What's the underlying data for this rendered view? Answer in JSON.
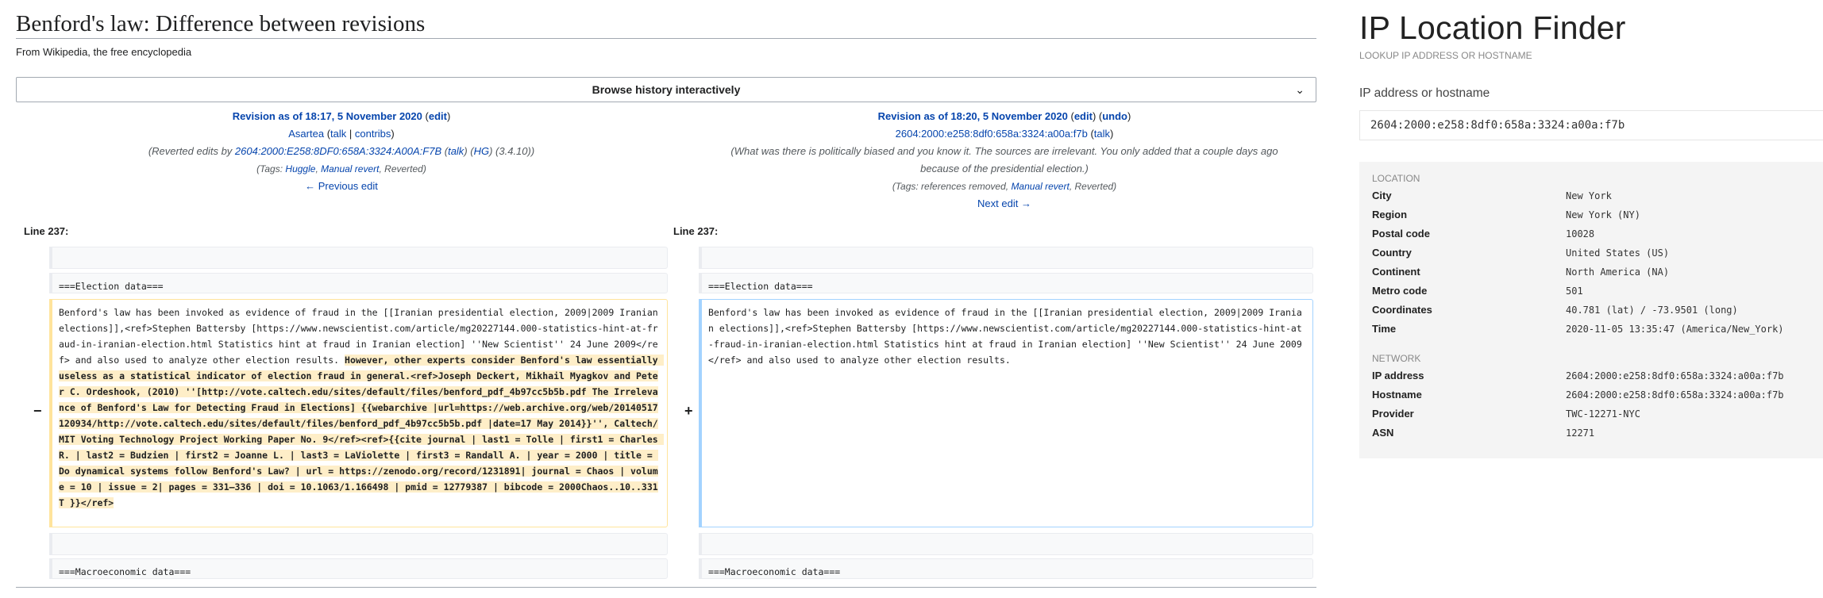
{
  "wiki": {
    "title": "Benford's law: Difference between revisions",
    "tagline": "From Wikipedia, the free encyclopedia",
    "browse_label": "Browse history interactively",
    "left_rev": {
      "heading": "Revision as of 18:17, 5 November 2020",
      "edit": "edit",
      "user": "Asartea",
      "talk": "talk",
      "contribs": "contribs",
      "summary_prefix": "(Reverted edits by ",
      "summary_ip": "2604:2000:E258:8DF0:658A:3324:A00A:F7B",
      "summary_talk": "talk",
      "summary_hg": "HG",
      "summary_suffix": "(3.4.10))",
      "tags_prefix": "(Tags: ",
      "tag1": "Huggle",
      "tag2": "Manual revert",
      "tags_suffix": ", Reverted)",
      "nav": "← Previous edit"
    },
    "right_rev": {
      "heading": "Revision as of 18:20, 5 November 2020",
      "edit": "edit",
      "undo": "undo",
      "user": "2604:2000:e258:8df0:658a:3324:a00a:f7b",
      "talk": "talk",
      "summary_line1": "(What was there is politically biased and you know it. The sources are irrelevant. You only added that a couple days ago",
      "summary_line2": "because of the presidential election.)",
      "tags_prefix": "(Tags: references removed, ",
      "tag1": "Manual revert",
      "tags_suffix": ", Reverted)",
      "nav": "Next edit →"
    },
    "line_label_left": "Line 237:",
    "line_label_right": "Line 237:",
    "context_election": "===Election data===",
    "context_macro": "===Macroeconomic data===",
    "marker_minus": "−",
    "marker_plus": "+",
    "removed_before": "Benford's law has been invoked as evidence of fraud in the [[Iranian presidential election, 2009|2009 Iranian elections]],<ref>Stephen Battersby [https://www.newscientist.com/article/mg20227144.000-statistics-hint-at-fraud-in-iranian-election.html Statistics hint at fraud in Iranian election] ''New Scientist'' 24 June 2009</ref> and also used to analyze other election results. ",
    "removed_highlight": "However, other experts consider Benford's law essentially useless as a statistical indicator of election fraud in general.<ref>Joseph Deckert, Mikhail Myagkov and Peter C. Ordeshook, (2010) ''[http://vote.caltech.edu/sites/default/files/benford_pdf_4b97cc5b5b.pdf The Irrelevance of Benford's Law for Detecting Fraud in Elections] {{webarchive |url=https://web.archive.org/web/20140517120934/http://vote.caltech.edu/sites/default/files/benford_pdf_4b97cc5b5b.pdf |date=17 May 2014}}'', Caltech/MIT Voting Technology Project Working Paper No. 9</ref><ref>{{cite journal | last1 = Tolle | first1 = Charles R. | last2 = Budzien | first2 = Joanne L. | last3 = LaViolette | first3 = Randall A. | year = 2000 | title = Do dynamical systems follow Benford's Law? | url = https://zenodo.org/record/1231891| journal = Chaos | volume = 10 | issue = 2| pages = 331–336 | doi = 10.1063/1.166498 | pmid = 12779387 | bibcode = 2000Chaos..10..331T }}</ref>",
    "added_text": "Benford's law has been invoked as evidence of fraud in the [[Iranian presidential election, 2009|2009 Iranian elections]],<ref>Stephen Battersby [https://www.newscientist.com/article/mg20227144.000-statistics-hint-at-fraud-in-iranian-election.html Statistics hint at fraud in Iranian election] ''New Scientist'' 24 June 2009</ref> and also used to analyze other election results."
  },
  "ip": {
    "title": "IP Location Finder",
    "subtitle": "LOOKUP IP ADDRESS OR HOSTNAME",
    "field_label": "IP address or hostname",
    "field_value": "2604:2000:e258:8df0:658a:3324:a00a:f7b",
    "location_header": "LOCATION",
    "location_rows": [
      {
        "k": "City",
        "v": "New York"
      },
      {
        "k": "Region",
        "v": "New York (NY)"
      },
      {
        "k": "Postal code",
        "v": "10028"
      },
      {
        "k": "Country",
        "v": "United States (US)"
      },
      {
        "k": "Continent",
        "v": "North America (NA)"
      },
      {
        "k": "Metro code",
        "v": "501"
      },
      {
        "k": "Coordinates",
        "v": "40.781 (lat) / -73.9501 (long)"
      },
      {
        "k": "Time",
        "v": "2020-11-05 13:35:47 (America/New_York)"
      }
    ],
    "network_header": "NETWORK",
    "network_rows": [
      {
        "k": "IP address",
        "v": "2604:2000:e258:8df0:658a:3324:a00a:f7b"
      },
      {
        "k": "Hostname",
        "v": "2604:2000:e258:8df0:658a:3324:a00a:f7b"
      },
      {
        "k": "Provider",
        "v": "TWC-12271-NYC"
      },
      {
        "k": "ASN",
        "v": "12271"
      }
    ]
  }
}
